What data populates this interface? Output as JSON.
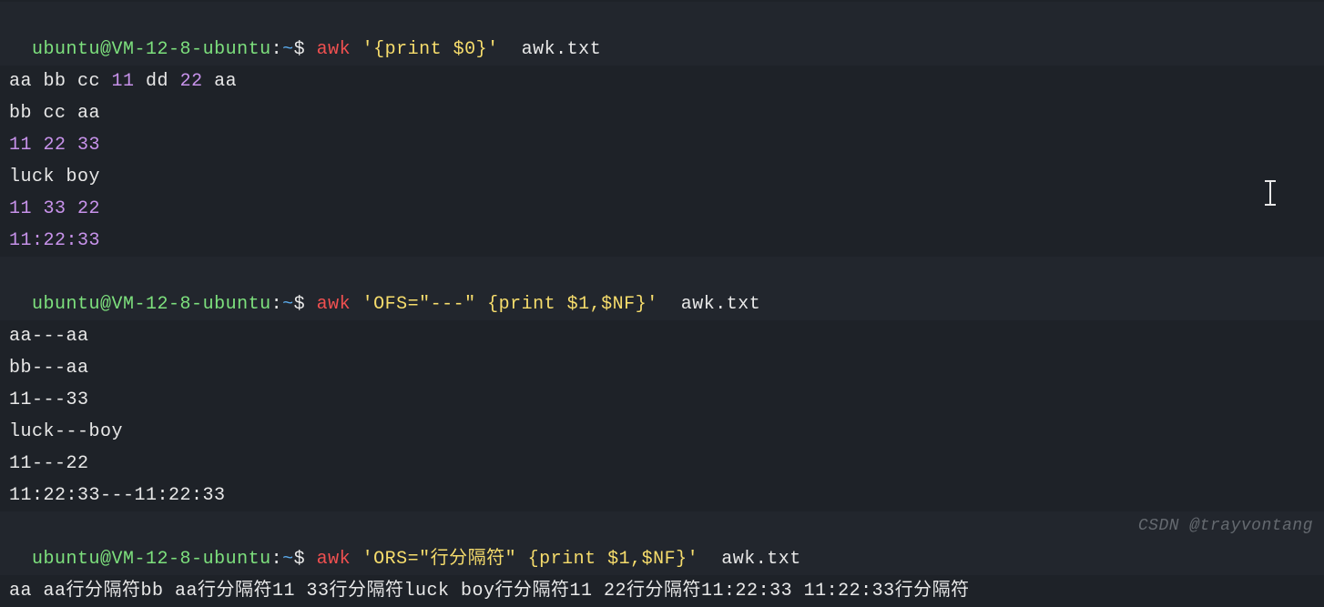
{
  "prompt": {
    "user": "ubuntu",
    "at": "@",
    "host": "VM-12-8-ubuntu",
    "colon": ":",
    "path": "~",
    "dollar": "$ "
  },
  "cmd1": {
    "awk": "awk ",
    "q1": "'{print $0}'",
    "file": "  awk.txt"
  },
  "out1": {
    "l1a": "aa bb cc ",
    "l1b": "11",
    "l1c": " dd ",
    "l1d": "22",
    "l1e": " aa",
    "l2": "bb cc aa",
    "l3": "11 22 33",
    "l4": "luck boy",
    "l5": "11 33 22",
    "l6": "11:22:33"
  },
  "cmd2": {
    "awk": "awk ",
    "q1": "'OFS=\"---\" {print $1,$NF}'",
    "file": "  awk.txt"
  },
  "out2": {
    "l1": "aa---aa",
    "l2": "bb---aa",
    "l3": "11---33",
    "l4": "luck---boy",
    "l5": "11---22",
    "l6": "11:22:33---11:22:33"
  },
  "cmd3": {
    "awk": "awk ",
    "q1": "'ORS=\"行分隔符\" {print $1,$NF}'",
    "file": "  awk.txt"
  },
  "out3": {
    "l1": "aa aa行分隔符bb aa行分隔符11 33行分隔符luck boy行分隔符11 22行分隔符11:22:33 11:22:33行分隔符"
  },
  "watermark": "CSDN @trayvontang"
}
